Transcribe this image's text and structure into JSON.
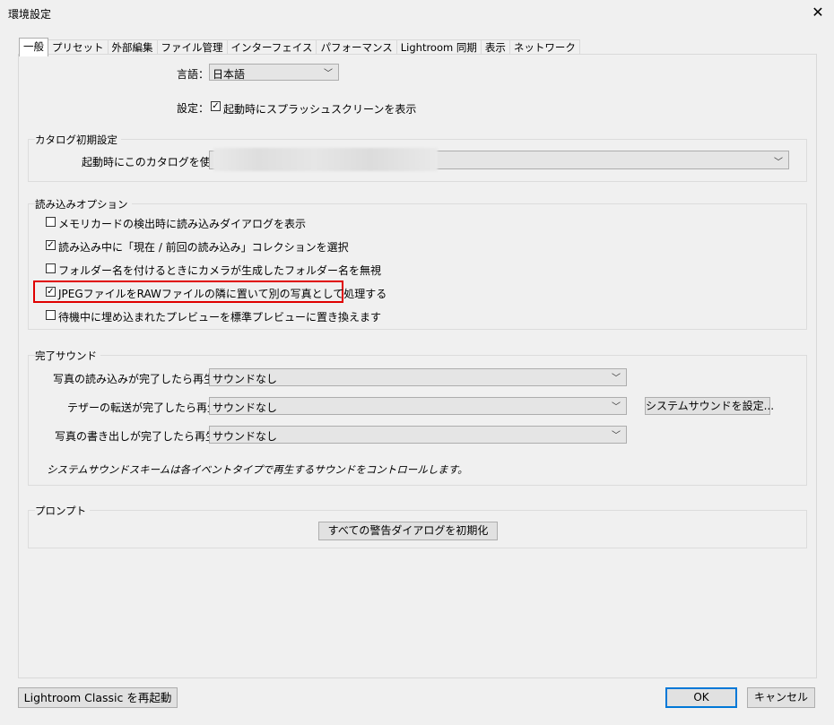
{
  "window": {
    "title": "環境設定"
  },
  "tabs": [
    "一般",
    "プリセット",
    "外部編集",
    "ファイル管理",
    "インターフェイス",
    "パフォーマンス",
    "Lightroom 同期",
    "表示",
    "ネットワーク"
  ],
  "language": {
    "label": "言語：",
    "value": "日本語"
  },
  "settings": {
    "label": "設定：",
    "splash_label": "起動時にスプラッシュスクリーンを表示",
    "splash_checked": true
  },
  "catalog": {
    "title": "カタログ初期設定",
    "label": "起動時にこのカタログを使用："
  },
  "import": {
    "title": "読み込みオプション",
    "options": [
      {
        "label": "メモリカードの検出時に読み込みダイアログを表示",
        "checked": false
      },
      {
        "label": "読み込み中に「現在 / 前回の読み込み」コレクションを選択",
        "checked": true
      },
      {
        "label": "フォルダー名を付けるときにカメラが生成したフォルダー名を無視",
        "checked": false
      },
      {
        "label": "JPEGファイルをRAWファイルの隣に置いて別の写真として処理する",
        "checked": true
      },
      {
        "label": "待機中に埋め込まれたプレビューを標準プレビューに置き換えます",
        "checked": false
      }
    ]
  },
  "sound": {
    "title": "完了サウンド",
    "rows": [
      {
        "label": "写真の読み込みが完了したら再生：",
        "value": "サウンドなし"
      },
      {
        "label": "テザーの転送が完了したら再生：",
        "value": "サウンドなし"
      },
      {
        "label": "写真の書き出しが完了したら再生：",
        "value": "サウンドなし"
      }
    ],
    "system_button": "システムサウンドを設定...",
    "note": "システムサウンドスキームは各イベントタイプで再生するサウンドをコントロールします。"
  },
  "prompt": {
    "title": "プロンプト",
    "reset_button": "すべての警告ダイアログを初期化"
  },
  "footer": {
    "restart_button": "Lightroom Classic を再起動",
    "ok_button": "OK",
    "cancel_button": "キャンセル"
  },
  "check_mark": "✓"
}
